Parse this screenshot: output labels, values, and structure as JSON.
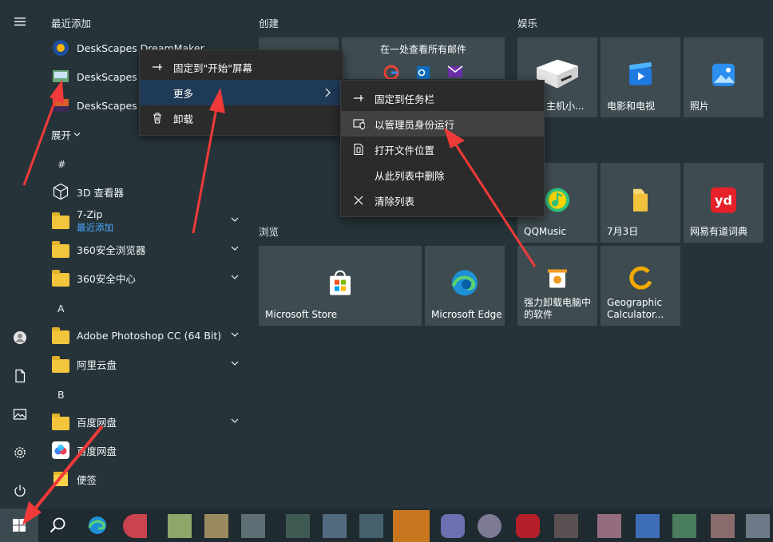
{
  "recent": {
    "header": "最近添加",
    "items": [
      {
        "label": "DeskScapes DreamMaker"
      },
      {
        "label": "DeskScapes D"
      },
      {
        "label": "DeskScapes 1"
      }
    ],
    "expand_label": "展开"
  },
  "app_list": {
    "hash_head": "#",
    "items": [
      {
        "label": "3D 查看器"
      },
      {
        "label": "7-Zip",
        "sub": "最近添加"
      },
      {
        "label": "360安全浏览器"
      },
      {
        "label": "360安全中心"
      }
    ],
    "a_head": "A",
    "a_items": [
      {
        "label": "Adobe Photoshop CC (64 Bit)"
      },
      {
        "label": "阿里云盘"
      }
    ],
    "b_head": "B",
    "b_items": [
      {
        "label": "百度网盘"
      },
      {
        "label": "百度网盘"
      },
      {
        "label": "便签"
      }
    ]
  },
  "tiles": {
    "create_title": "创建",
    "mail_tile": {
      "label": "在一处查看所有邮件"
    },
    "browse_title": "浏览",
    "browse": [
      {
        "label": "Microsoft Store"
      },
      {
        "label": "Microsoft Edge"
      }
    ],
    "ent_title": "娱乐",
    "ent": [
      {
        "label": "主机小..."
      },
      {
        "label": "电影和电视"
      },
      {
        "label": "照片"
      },
      {
        "label": "QQMusic"
      },
      {
        "label": "7月3日"
      },
      {
        "label": "网易有道词典"
      },
      {
        "label": "强力卸载电脑中的软件"
      },
      {
        "label": "Geographic Calculator..."
      }
    ]
  },
  "context_menu": {
    "items": [
      {
        "label": "固定到\"开始\"屏幕"
      },
      {
        "label": "更多"
      },
      {
        "label": "卸载"
      }
    ]
  },
  "submenu": {
    "items": [
      {
        "label": "固定到任务栏"
      },
      {
        "label": "以管理员身份运行"
      },
      {
        "label": "打开文件位置"
      },
      {
        "label": "从此列表中删除"
      },
      {
        "label": "清除列表"
      }
    ]
  },
  "colors": {
    "accent": "#4aa8ff",
    "arrow": "#f03a3a",
    "menu_hover": "#414141"
  }
}
